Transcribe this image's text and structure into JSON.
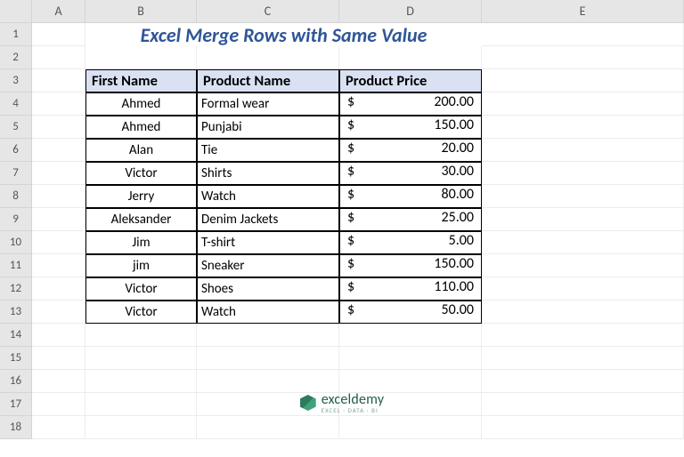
{
  "columns": [
    "A",
    "B",
    "C",
    "D",
    "E"
  ],
  "rowCount": 18,
  "title": "Excel Merge Rows with Same Value",
  "headers": {
    "b": "First Name",
    "c": "Product Name",
    "d": "Product Price"
  },
  "rows": [
    {
      "name": "Ahmed",
      "product": "Formal wear",
      "price": "200.00"
    },
    {
      "name": "Ahmed",
      "product": "Punjabi",
      "price": "150.00"
    },
    {
      "name": "Alan",
      "product": "Tie",
      "price": "20.00"
    },
    {
      "name": "Victor",
      "product": "Shirts",
      "price": "30.00"
    },
    {
      "name": "Jerry",
      "product": "Watch",
      "price": "80.00"
    },
    {
      "name": "Aleksander",
      "product": "Denim Jackets",
      "price": "25.00"
    },
    {
      "name": "Jim",
      "product": "T-shirt",
      "price": "5.00"
    },
    {
      "name": "jim",
      "product": "Sneaker",
      "price": "150.00"
    },
    {
      "name": "Victor",
      "product": "Shoes",
      "price": "110.00"
    },
    {
      "name": "Victor",
      "product": "Watch",
      "price": "50.00"
    }
  ],
  "currency": "$",
  "footer": {
    "brand": "exceldemy",
    "tagline": "EXCEL · DATA · BI"
  }
}
